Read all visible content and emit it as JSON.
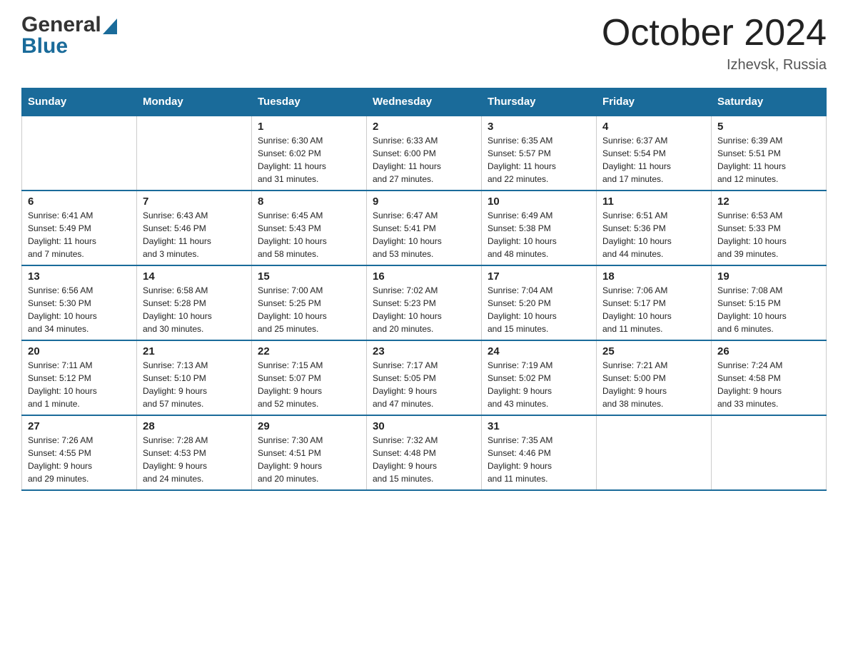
{
  "header": {
    "month_title": "October 2024",
    "location": "Izhevsk, Russia",
    "logo_general": "General",
    "logo_blue": "Blue"
  },
  "days_of_week": [
    "Sunday",
    "Monday",
    "Tuesday",
    "Wednesday",
    "Thursday",
    "Friday",
    "Saturday"
  ],
  "weeks": [
    [
      {
        "day": "",
        "info": ""
      },
      {
        "day": "",
        "info": ""
      },
      {
        "day": "1",
        "info": "Sunrise: 6:30 AM\nSunset: 6:02 PM\nDaylight: 11 hours\nand 31 minutes."
      },
      {
        "day": "2",
        "info": "Sunrise: 6:33 AM\nSunset: 6:00 PM\nDaylight: 11 hours\nand 27 minutes."
      },
      {
        "day": "3",
        "info": "Sunrise: 6:35 AM\nSunset: 5:57 PM\nDaylight: 11 hours\nand 22 minutes."
      },
      {
        "day": "4",
        "info": "Sunrise: 6:37 AM\nSunset: 5:54 PM\nDaylight: 11 hours\nand 17 minutes."
      },
      {
        "day": "5",
        "info": "Sunrise: 6:39 AM\nSunset: 5:51 PM\nDaylight: 11 hours\nand 12 minutes."
      }
    ],
    [
      {
        "day": "6",
        "info": "Sunrise: 6:41 AM\nSunset: 5:49 PM\nDaylight: 11 hours\nand 7 minutes."
      },
      {
        "day": "7",
        "info": "Sunrise: 6:43 AM\nSunset: 5:46 PM\nDaylight: 11 hours\nand 3 minutes."
      },
      {
        "day": "8",
        "info": "Sunrise: 6:45 AM\nSunset: 5:43 PM\nDaylight: 10 hours\nand 58 minutes."
      },
      {
        "day": "9",
        "info": "Sunrise: 6:47 AM\nSunset: 5:41 PM\nDaylight: 10 hours\nand 53 minutes."
      },
      {
        "day": "10",
        "info": "Sunrise: 6:49 AM\nSunset: 5:38 PM\nDaylight: 10 hours\nand 48 minutes."
      },
      {
        "day": "11",
        "info": "Sunrise: 6:51 AM\nSunset: 5:36 PM\nDaylight: 10 hours\nand 44 minutes."
      },
      {
        "day": "12",
        "info": "Sunrise: 6:53 AM\nSunset: 5:33 PM\nDaylight: 10 hours\nand 39 minutes."
      }
    ],
    [
      {
        "day": "13",
        "info": "Sunrise: 6:56 AM\nSunset: 5:30 PM\nDaylight: 10 hours\nand 34 minutes."
      },
      {
        "day": "14",
        "info": "Sunrise: 6:58 AM\nSunset: 5:28 PM\nDaylight: 10 hours\nand 30 minutes."
      },
      {
        "day": "15",
        "info": "Sunrise: 7:00 AM\nSunset: 5:25 PM\nDaylight: 10 hours\nand 25 minutes."
      },
      {
        "day": "16",
        "info": "Sunrise: 7:02 AM\nSunset: 5:23 PM\nDaylight: 10 hours\nand 20 minutes."
      },
      {
        "day": "17",
        "info": "Sunrise: 7:04 AM\nSunset: 5:20 PM\nDaylight: 10 hours\nand 15 minutes."
      },
      {
        "day": "18",
        "info": "Sunrise: 7:06 AM\nSunset: 5:17 PM\nDaylight: 10 hours\nand 11 minutes."
      },
      {
        "day": "19",
        "info": "Sunrise: 7:08 AM\nSunset: 5:15 PM\nDaylight: 10 hours\nand 6 minutes."
      }
    ],
    [
      {
        "day": "20",
        "info": "Sunrise: 7:11 AM\nSunset: 5:12 PM\nDaylight: 10 hours\nand 1 minute."
      },
      {
        "day": "21",
        "info": "Sunrise: 7:13 AM\nSunset: 5:10 PM\nDaylight: 9 hours\nand 57 minutes."
      },
      {
        "day": "22",
        "info": "Sunrise: 7:15 AM\nSunset: 5:07 PM\nDaylight: 9 hours\nand 52 minutes."
      },
      {
        "day": "23",
        "info": "Sunrise: 7:17 AM\nSunset: 5:05 PM\nDaylight: 9 hours\nand 47 minutes."
      },
      {
        "day": "24",
        "info": "Sunrise: 7:19 AM\nSunset: 5:02 PM\nDaylight: 9 hours\nand 43 minutes."
      },
      {
        "day": "25",
        "info": "Sunrise: 7:21 AM\nSunset: 5:00 PM\nDaylight: 9 hours\nand 38 minutes."
      },
      {
        "day": "26",
        "info": "Sunrise: 7:24 AM\nSunset: 4:58 PM\nDaylight: 9 hours\nand 33 minutes."
      }
    ],
    [
      {
        "day": "27",
        "info": "Sunrise: 7:26 AM\nSunset: 4:55 PM\nDaylight: 9 hours\nand 29 minutes."
      },
      {
        "day": "28",
        "info": "Sunrise: 7:28 AM\nSunset: 4:53 PM\nDaylight: 9 hours\nand 24 minutes."
      },
      {
        "day": "29",
        "info": "Sunrise: 7:30 AM\nSunset: 4:51 PM\nDaylight: 9 hours\nand 20 minutes."
      },
      {
        "day": "30",
        "info": "Sunrise: 7:32 AM\nSunset: 4:48 PM\nDaylight: 9 hours\nand 15 minutes."
      },
      {
        "day": "31",
        "info": "Sunrise: 7:35 AM\nSunset: 4:46 PM\nDaylight: 9 hours\nand 11 minutes."
      },
      {
        "day": "",
        "info": ""
      },
      {
        "day": "",
        "info": ""
      }
    ]
  ]
}
